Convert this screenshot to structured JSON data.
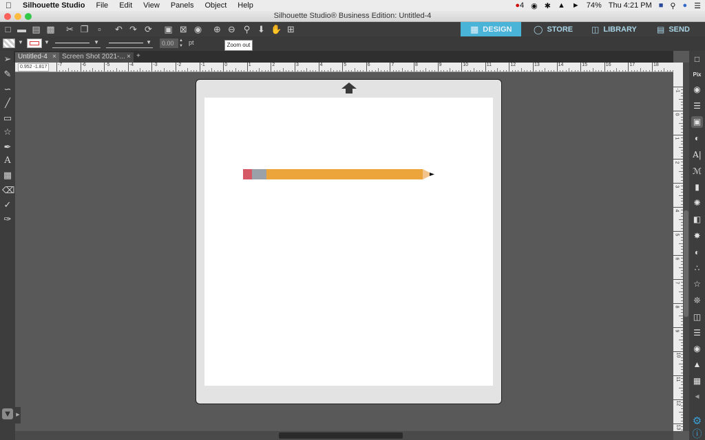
{
  "menubar": {
    "apple_icon": "apple-icon",
    "app_name": "Silhouette Studio",
    "items": [
      "File",
      "Edit",
      "View",
      "Panels",
      "Object",
      "Help"
    ],
    "status": {
      "notification_count": "4",
      "battery": "74%",
      "clock": "Thu 4:21 PM"
    }
  },
  "window": {
    "title": "Silhouette Studio® Business Edition: Untitled-4"
  },
  "top_tabs": {
    "design": "DESIGN",
    "store": "STORE",
    "library": "LIBRARY",
    "send": "SEND"
  },
  "line_settings": {
    "thickness": "0.00",
    "unit": "pt"
  },
  "tooltip": {
    "text": "Zoom out"
  },
  "doc_tabs": [
    {
      "label": "Untitled-4",
      "close": "×"
    },
    {
      "label": "Screen Shot 2021-...",
      "close": "×"
    }
  ],
  "doc_tabs_add": "+",
  "coords": {
    "x": "0.952",
    "y": "-1.817"
  },
  "ruler": {
    "h_labels": [
      "-7",
      "-6",
      "-5",
      "-4",
      "-3",
      "-2",
      "-1",
      "0",
      "1",
      "2",
      "3",
      "4",
      "5",
      "6",
      "7",
      "8",
      "9",
      "10",
      "11",
      "12",
      "13",
      "14",
      "15",
      "16",
      "17",
      "18",
      "19"
    ],
    "v_labels": [
      "-1",
      "0",
      "1",
      "2",
      "3",
      "4",
      "5",
      "6",
      "7",
      "8",
      "9",
      "10",
      "11",
      "12",
      "13"
    ]
  },
  "colors": {
    "accent": "#4ab3d8",
    "pencil_body": "#eca53a",
    "pencil_eraser": "#d65a66",
    "pencil_ferrule": "#9aa1a8",
    "pencil_tip": "#f2c48c"
  }
}
